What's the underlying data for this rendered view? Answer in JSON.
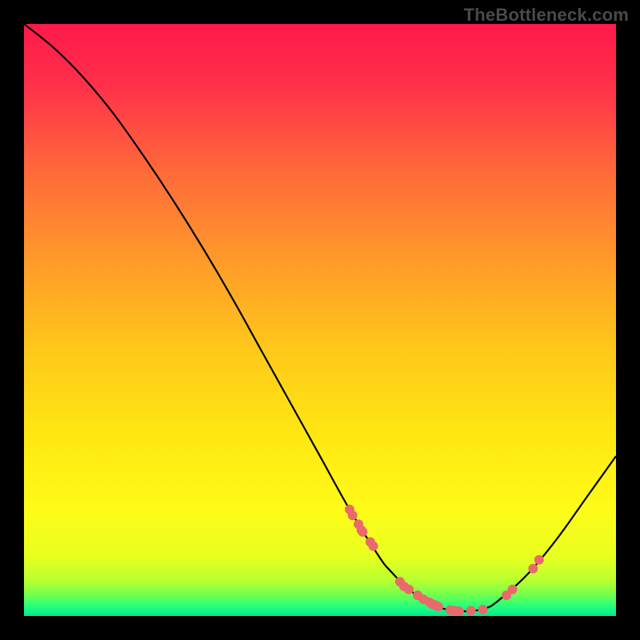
{
  "watermark": "TheBottleneck.com",
  "chart_data": {
    "type": "line",
    "title": "",
    "xlabel": "",
    "ylabel": "",
    "xlim": [
      0,
      100
    ],
    "ylim": [
      0,
      100
    ],
    "grid": false,
    "series": [
      {
        "name": "curve",
        "x": [
          0,
          5,
          10,
          15,
          20,
          25,
          30,
          35,
          40,
          45,
          50,
          55,
          60,
          62,
          65,
          68,
          70,
          72,
          74,
          76,
          78,
          80,
          85,
          90,
          95,
          100
        ],
        "y": [
          100,
          96,
          91,
          85,
          78,
          70.5,
          62.5,
          54,
          45,
          36,
          27,
          18,
          10,
          7.5,
          4.5,
          2.5,
          1.5,
          1.0,
          0.8,
          0.9,
          1.3,
          2.5,
          7,
          13,
          20,
          27
        ]
      }
    ],
    "markers": [
      {
        "x": 55.0,
        "y": 18.0
      },
      {
        "x": 55.5,
        "y": 17.0
      },
      {
        "x": 56.5,
        "y": 15.5
      },
      {
        "x": 57.0,
        "y": 14.5
      },
      {
        "x": 57.2,
        "y": 14.2
      },
      {
        "x": 58.5,
        "y": 12.5
      },
      {
        "x": 59.0,
        "y": 11.8
      },
      {
        "x": 63.5,
        "y": 5.8
      },
      {
        "x": 64.2,
        "y": 5.0
      },
      {
        "x": 65.0,
        "y": 4.5
      },
      {
        "x": 66.5,
        "y": 3.5
      },
      {
        "x": 67.5,
        "y": 2.8
      },
      {
        "x": 68.5,
        "y": 2.3
      },
      {
        "x": 69.0,
        "y": 2.0
      },
      {
        "x": 69.5,
        "y": 1.8
      },
      {
        "x": 70.0,
        "y": 1.6
      },
      {
        "x": 72.0,
        "y": 1.0
      },
      {
        "x": 72.8,
        "y": 0.9
      },
      {
        "x": 73.5,
        "y": 0.8
      },
      {
        "x": 75.5,
        "y": 0.9
      },
      {
        "x": 77.5,
        "y": 1.1
      },
      {
        "x": 81.5,
        "y": 3.5
      },
      {
        "x": 82.5,
        "y": 4.5
      },
      {
        "x": 86.0,
        "y": 8.0
      },
      {
        "x": 87.0,
        "y": 9.5
      }
    ],
    "gradient_stops": [
      {
        "offset": 0.0,
        "color": "#ff1a4a"
      },
      {
        "offset": 0.1,
        "color": "#ff2f4a"
      },
      {
        "offset": 0.25,
        "color": "#ff6a3a"
      },
      {
        "offset": 0.4,
        "color": "#ff9a2a"
      },
      {
        "offset": 0.55,
        "color": "#ffc81a"
      },
      {
        "offset": 0.7,
        "color": "#ffe812"
      },
      {
        "offset": 0.82,
        "color": "#fffb18"
      },
      {
        "offset": 0.9,
        "color": "#e8ff20"
      },
      {
        "offset": 0.94,
        "color": "#b8ff30"
      },
      {
        "offset": 0.965,
        "color": "#70ff50"
      },
      {
        "offset": 0.985,
        "color": "#20ff80"
      },
      {
        "offset": 1.0,
        "color": "#00e890"
      }
    ],
    "curve_color": "#000000",
    "marker_color": "#e86a6a"
  }
}
